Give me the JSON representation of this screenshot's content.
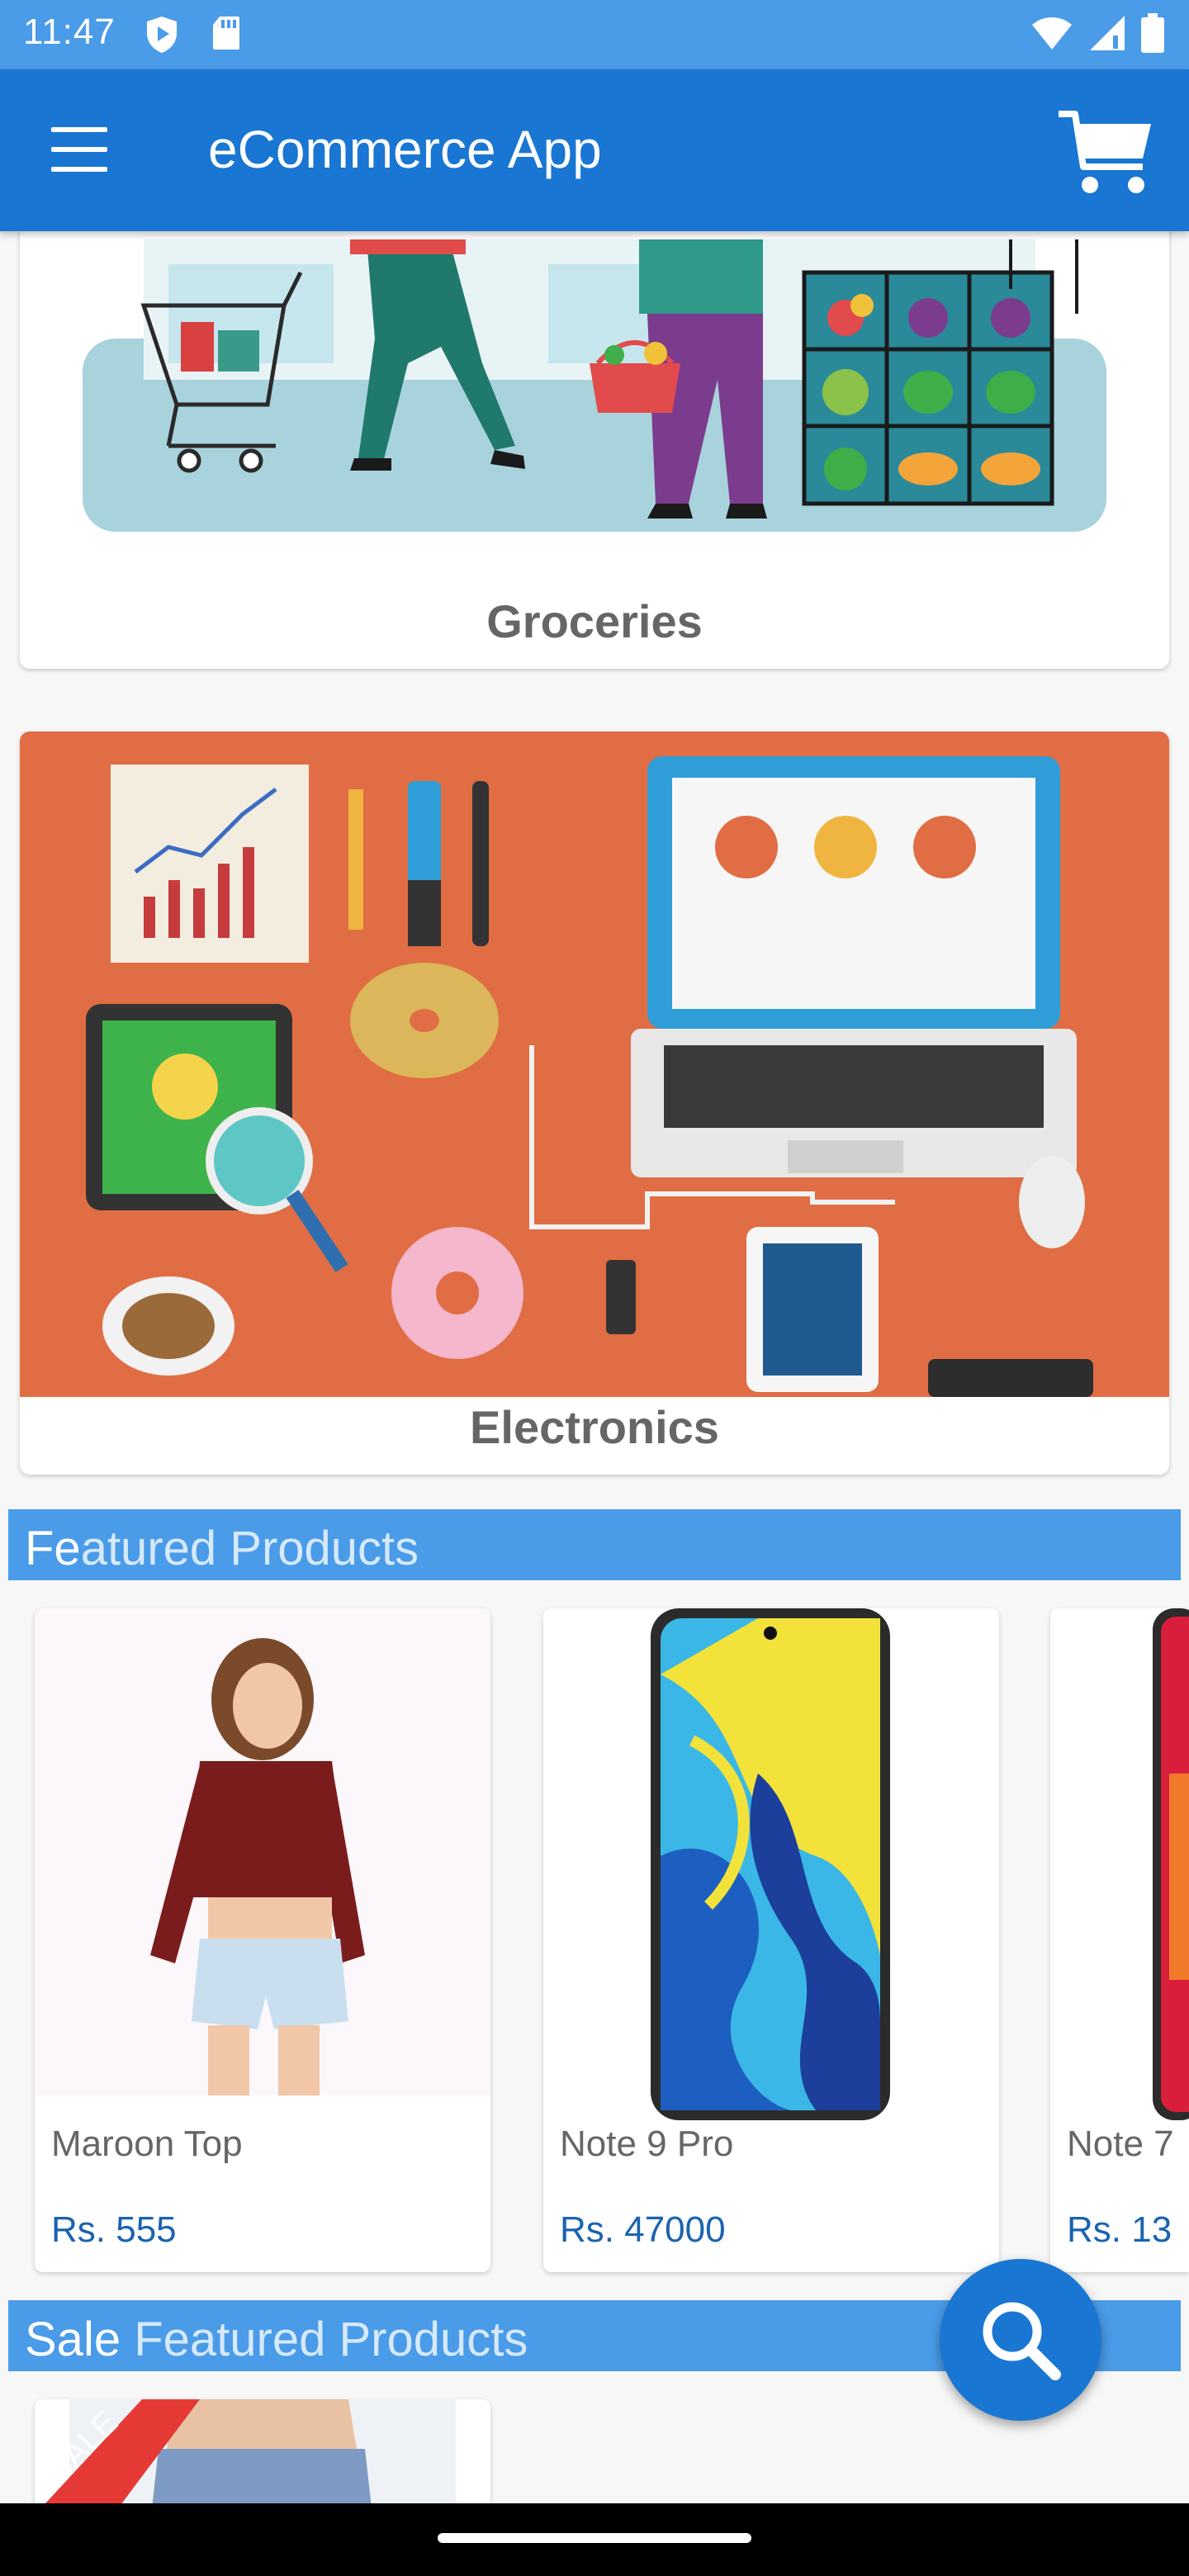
{
  "status_bar": {
    "time": "11:47",
    "icons": [
      "play-protect-icon",
      "sd-card-icon",
      "wifi-icon",
      "cellular-signal-icon",
      "battery-icon"
    ]
  },
  "app_bar": {
    "title": "eCommerce App",
    "menu_icon": "hamburger-menu-icon",
    "cart_icon": "shopping-cart-icon"
  },
  "categories": [
    {
      "label": "Groceries",
      "image": "groceries-illustration"
    },
    {
      "label": "Electronics",
      "image": "electronics-illustration"
    }
  ],
  "featured": {
    "title_a": "Fe",
    "title_b": "atured Products",
    "products": [
      {
        "name": "Maroon Top",
        "price": "Rs. 555"
      },
      {
        "name": "Note 9 Pro",
        "price": "Rs. 47000"
      },
      {
        "name": "Note 7",
        "price": "Rs. 13"
      }
    ]
  },
  "sale_featured": {
    "title_a": "Sale",
    "title_b": " Featured Products",
    "badge": "SALE"
  },
  "fab": {
    "icon": "search-icon"
  },
  "colors": {
    "status_bar": "#4a9be8",
    "app_bar": "#1976d2",
    "section_header": "#4a9be8",
    "price": "#1a63b0",
    "sale_badge": "#e53935"
  }
}
